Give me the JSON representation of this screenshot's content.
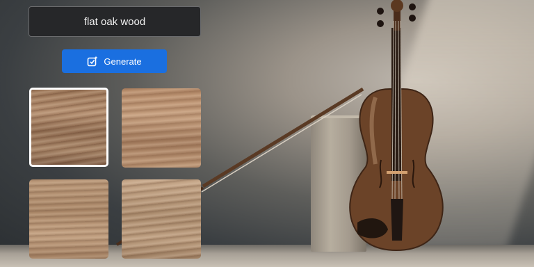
{
  "prompt": {
    "text": "flat oak wood"
  },
  "generate_button": {
    "label": "Generate",
    "icon": "generate-icon"
  },
  "results": {
    "selected_index": 0,
    "items": [
      {
        "name": "wood-texture-1",
        "selected": true
      },
      {
        "name": "wood-texture-2",
        "selected": false
      },
      {
        "name": "wood-texture-3",
        "selected": false
      },
      {
        "name": "wood-texture-4",
        "selected": false
      }
    ]
  },
  "colors": {
    "accent": "#1a6fe0",
    "prompt_bg": "#262729",
    "selected_border": "#ffffff"
  }
}
